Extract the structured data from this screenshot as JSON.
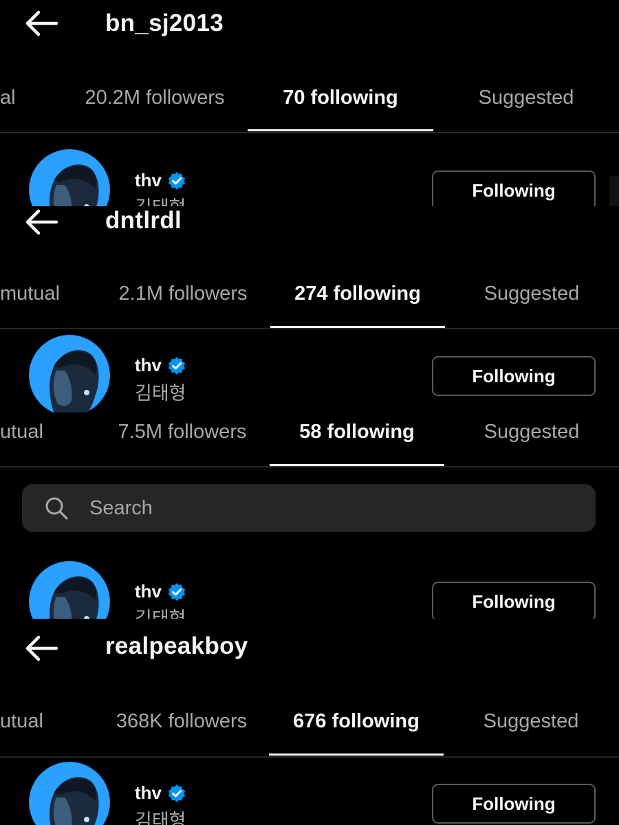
{
  "panels": [
    {
      "username": "bn_sj2013",
      "tabs": {
        "left_partial": "al",
        "followers": "20.2M followers",
        "following": "70 following",
        "suggested": "Suggested"
      },
      "row": {
        "username": "thv",
        "full_name": "김태형",
        "button": "Following"
      }
    },
    {
      "username": "dntlrdl",
      "tabs": {
        "left_partial": "mutual",
        "followers": "2.1M followers",
        "following": "274 following",
        "suggested": "Suggested"
      },
      "row": {
        "username": "thv",
        "full_name": "김태형",
        "button": "Following"
      }
    },
    {
      "tabs": {
        "left_partial": "utual",
        "followers": "7.5M followers",
        "following": "58 following",
        "suggested": "Suggested"
      },
      "search": {
        "placeholder": "Search"
      },
      "row": {
        "username": "thv",
        "full_name": "김태형",
        "button": "Following"
      }
    },
    {
      "username": "realpeakboy",
      "tabs": {
        "left_partial": "utual",
        "followers": "368K followers",
        "following": "676 following",
        "suggested": "Suggested"
      },
      "row": {
        "username": "thv",
        "full_name": "김태형",
        "button": "Following"
      }
    }
  ],
  "icons": {
    "back": "back-arrow-icon",
    "verified": "verified-badge-icon",
    "search": "search-icon"
  },
  "colors": {
    "background": "#000000",
    "text_primary": "#f5f5f5",
    "text_secondary": "#a8a8a8",
    "verified_blue": "#0095f6",
    "divider": "#262626",
    "search_bg": "#262626",
    "button_border": "#5a5a5a"
  }
}
